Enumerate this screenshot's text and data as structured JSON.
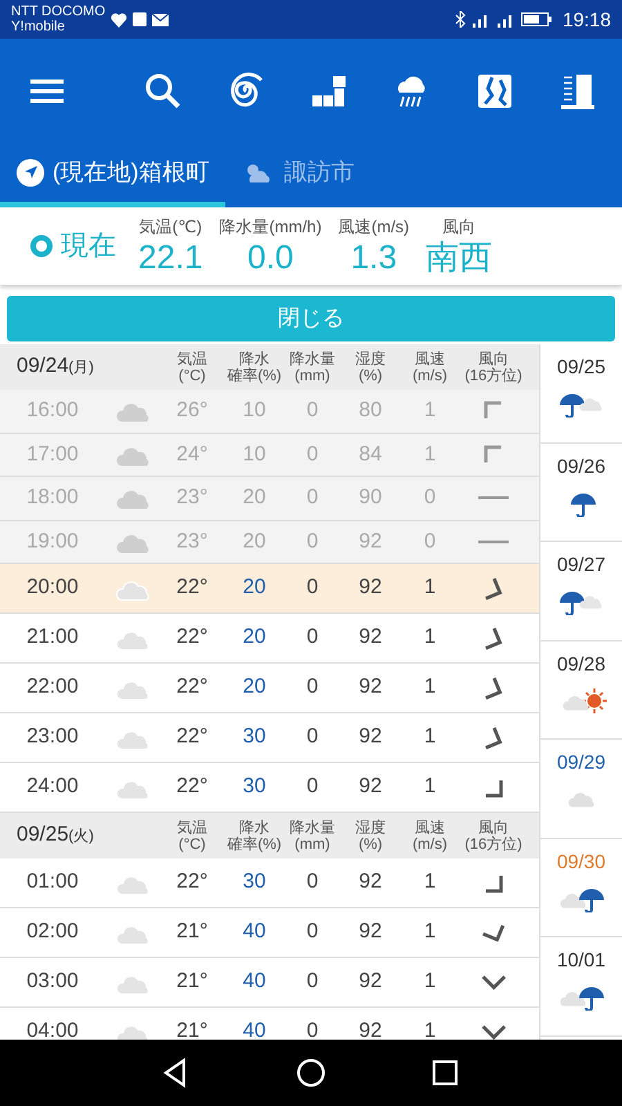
{
  "status_bar": {
    "carriers": [
      "NTT DOCOMO",
      "Y!mobile"
    ],
    "time": "19:18"
  },
  "tabs": [
    {
      "label": "(現在地)箱根町",
      "kind": "location",
      "selected": true
    },
    {
      "label": "諏訪市",
      "kind": "weather",
      "selected": false
    }
  ],
  "current": {
    "label": "現在",
    "items": [
      {
        "label": "気温(℃)",
        "value": "22.1"
      },
      {
        "label": "降水量(mm/h)",
        "value": "0.0"
      },
      {
        "label": "風速(m/s)",
        "value": "1.3"
      },
      {
        "label": "風向",
        "value": "南西"
      }
    ]
  },
  "close_button": "閉じる",
  "days": [
    {
      "date": "09/24",
      "weekday": "(月)",
      "columns": [
        [
          "気温",
          "(°C)"
        ],
        [
          "降水",
          "確率(%)"
        ],
        [
          "降水量",
          "(mm)"
        ],
        [
          "湿度",
          "(%)"
        ],
        [
          "風速",
          "(m/s)"
        ],
        [
          "風向",
          "(16方位)"
        ]
      ],
      "rows": [
        {
          "time": "16:00",
          "temp": "26°",
          "prob": "10",
          "mm": "0",
          "humidity": "80",
          "speed": "1",
          "wind": {
            "kind": "n"
          },
          "past": true,
          "current": false
        },
        {
          "time": "17:00",
          "temp": "24°",
          "prob": "10",
          "mm": "0",
          "humidity": "84",
          "speed": "1",
          "wind": {
            "kind": "n"
          },
          "past": true,
          "current": false
        },
        {
          "time": "18:00",
          "temp": "23°",
          "prob": "20",
          "mm": "0",
          "humidity": "90",
          "speed": "0",
          "wind": {
            "kind": "calm"
          },
          "past": true,
          "current": false
        },
        {
          "time": "19:00",
          "temp": "23°",
          "prob": "20",
          "mm": "0",
          "humidity": "92",
          "speed": "0",
          "wind": {
            "kind": "calm"
          },
          "past": true,
          "current": false
        },
        {
          "time": "20:00",
          "temp": "22°",
          "prob": "20",
          "mm": "0",
          "humidity": "92",
          "speed": "1",
          "wind": {
            "kind": "sse"
          },
          "past": false,
          "current": true
        },
        {
          "time": "21:00",
          "temp": "22°",
          "prob": "20",
          "mm": "0",
          "humidity": "92",
          "speed": "1",
          "wind": {
            "kind": "sse"
          },
          "past": false,
          "current": false
        },
        {
          "time": "22:00",
          "temp": "22°",
          "prob": "20",
          "mm": "0",
          "humidity": "92",
          "speed": "1",
          "wind": {
            "kind": "sse"
          },
          "past": false,
          "current": false
        },
        {
          "time": "23:00",
          "temp": "22°",
          "prob": "30",
          "mm": "0",
          "humidity": "92",
          "speed": "1",
          "wind": {
            "kind": "sse"
          },
          "past": false,
          "current": false
        },
        {
          "time": "24:00",
          "temp": "22°",
          "prob": "30",
          "mm": "0",
          "humidity": "92",
          "speed": "1",
          "wind": {
            "kind": "s"
          },
          "past": false,
          "current": false
        }
      ]
    },
    {
      "date": "09/25",
      "weekday": "(火)",
      "columns": [
        [
          "気温",
          "(°C)"
        ],
        [
          "降水",
          "確率(%)"
        ],
        [
          "降水量",
          "(mm)"
        ],
        [
          "湿度",
          "(%)"
        ],
        [
          "風速",
          "(m/s)"
        ],
        [
          "風向",
          "(16方位)"
        ]
      ],
      "rows": [
        {
          "time": "01:00",
          "temp": "22°",
          "prob": "30",
          "mm": "0",
          "humidity": "92",
          "speed": "1",
          "wind": {
            "kind": "s"
          },
          "past": false,
          "current": false
        },
        {
          "time": "02:00",
          "temp": "21°",
          "prob": "40",
          "mm": "0",
          "humidity": "92",
          "speed": "1",
          "wind": {
            "kind": "ssw"
          },
          "past": false,
          "current": false
        },
        {
          "time": "03:00",
          "temp": "21°",
          "prob": "40",
          "mm": "0",
          "humidity": "92",
          "speed": "1",
          "wind": {
            "kind": "sw"
          },
          "past": false,
          "current": false
        },
        {
          "time": "04:00",
          "temp": "21°",
          "prob": "40",
          "mm": "0",
          "humidity": "92",
          "speed": "1",
          "wind": {
            "kind": "sw"
          },
          "past": false,
          "current": false
        }
      ]
    }
  ],
  "week": [
    {
      "date": "09/25",
      "kind": "rain-cloud",
      "color": "#333333"
    },
    {
      "date": "09/26",
      "kind": "rain",
      "color": "#333333"
    },
    {
      "date": "09/27",
      "kind": "rain-cloud",
      "color": "#333333"
    },
    {
      "date": "09/28",
      "kind": "cloud-sun",
      "color": "#333333"
    },
    {
      "date": "09/29",
      "kind": "cloud",
      "color": "#1f5fae"
    },
    {
      "date": "09/30",
      "kind": "cloud-rain",
      "color": "#e0782a"
    },
    {
      "date": "10/01",
      "kind": "cloud-rain",
      "color": "#333333"
    }
  ]
}
